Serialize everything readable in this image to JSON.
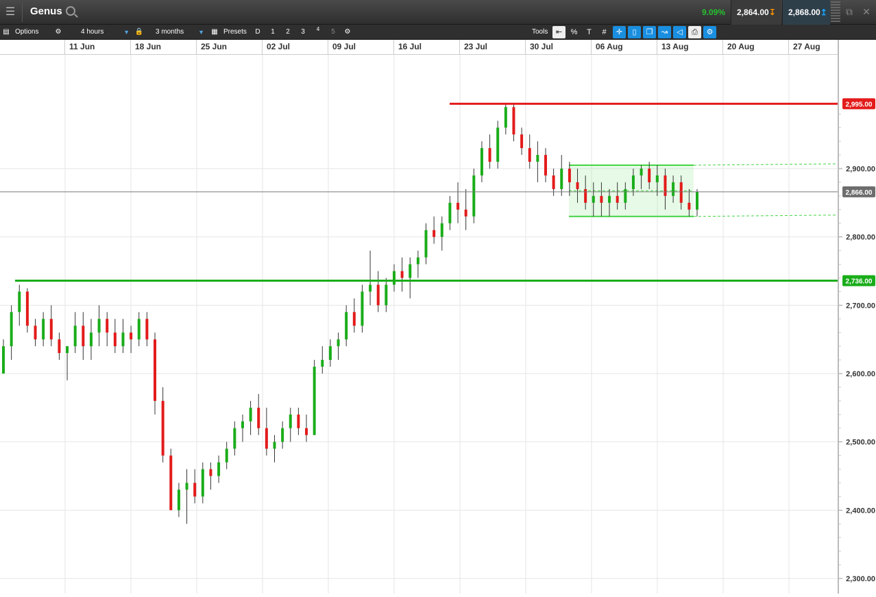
{
  "titlebar": {
    "title": "Genus",
    "change": "9.09%",
    "sell": "2,864.00",
    "buy": "2,868.00"
  },
  "toolbar": {
    "options": "Options",
    "interval": "4 hours",
    "range": "3 months",
    "presets": "Presets",
    "preset_buttons": [
      "D",
      "1",
      "2",
      "3",
      "4",
      "5"
    ],
    "tools": "Tools"
  },
  "chart_data": {
    "type": "candlestick",
    "x_ticks": [
      "11 Jun",
      "18 Jun",
      "25 Jun",
      "02 Jul",
      "09 Jul",
      "16 Jul",
      "23 Jul",
      "30 Jul",
      "06 Aug",
      "13 Aug",
      "20 Aug",
      "27 Aug"
    ],
    "y_ticks": [
      2300,
      2400,
      2500,
      2600,
      2700,
      2800,
      2900
    ],
    "y_tick_labels": [
      "2,300.00",
      "2,400.00",
      "2,500.00",
      "2,600.00",
      "2,700.00",
      "2,800.00",
      "2,900.00"
    ],
    "ylim": [
      2280,
      3010
    ],
    "current_price": 2866,
    "current_price_label": "2,866.00",
    "resistance": {
      "value": 2995,
      "label": "2,995.00",
      "color": "#e31b1b"
    },
    "support": {
      "value": 2736,
      "label": "2,736.00",
      "color": "#1aad1a"
    },
    "channel": {
      "upper": 2905,
      "lower": 2830,
      "color": "#42d442"
    },
    "colors": {
      "up": "#1aad1a",
      "down": "#e31b1b"
    },
    "candles": [
      [
        2600,
        2650,
        2600,
        2640
      ],
      [
        2640,
        2700,
        2620,
        2690
      ],
      [
        2690,
        2730,
        2670,
        2720
      ],
      [
        2720,
        2725,
        2660,
        2670
      ],
      [
        2670,
        2680,
        2640,
        2650
      ],
      [
        2650,
        2690,
        2640,
        2680
      ],
      [
        2680,
        2700,
        2640,
        2650
      ],
      [
        2650,
        2660,
        2620,
        2630
      ],
      [
        2630,
        2640,
        2590,
        2640
      ],
      [
        2640,
        2690,
        2630,
        2670
      ],
      [
        2670,
        2690,
        2620,
        2640
      ],
      [
        2640,
        2680,
        2620,
        2660
      ],
      [
        2660,
        2700,
        2640,
        2680
      ],
      [
        2680,
        2690,
        2640,
        2660
      ],
      [
        2660,
        2680,
        2630,
        2640
      ],
      [
        2640,
        2680,
        2630,
        2660
      ],
      [
        2660,
        2670,
        2630,
        2650
      ],
      [
        2650,
        2690,
        2640,
        2680
      ],
      [
        2680,
        2690,
        2640,
        2650
      ],
      [
        2650,
        2660,
        2540,
        2560
      ],
      [
        2560,
        2580,
        2470,
        2480
      ],
      [
        2480,
        2490,
        2400,
        2400
      ],
      [
        2400,
        2440,
        2390,
        2430
      ],
      [
        2430,
        2460,
        2380,
        2440
      ],
      [
        2440,
        2460,
        2410,
        2420
      ],
      [
        2420,
        2470,
        2410,
        2460
      ],
      [
        2460,
        2470,
        2430,
        2450
      ],
      [
        2450,
        2480,
        2440,
        2470
      ],
      [
        2470,
        2500,
        2460,
        2490
      ],
      [
        2490,
        2530,
        2480,
        2520
      ],
      [
        2520,
        2540,
        2500,
        2530
      ],
      [
        2530,
        2560,
        2510,
        2550
      ],
      [
        2550,
        2570,
        2510,
        2520
      ],
      [
        2520,
        2550,
        2480,
        2490
      ],
      [
        2490,
        2510,
        2470,
        2500
      ],
      [
        2500,
        2530,
        2490,
        2520
      ],
      [
        2520,
        2550,
        2500,
        2540
      ],
      [
        2540,
        2550,
        2510,
        2520
      ],
      [
        2520,
        2540,
        2500,
        2510
      ],
      [
        2510,
        2620,
        2510,
        2610
      ],
      [
        2610,
        2640,
        2600,
        2620
      ],
      [
        2620,
        2650,
        2610,
        2640
      ],
      [
        2640,
        2660,
        2620,
        2650
      ],
      [
        2650,
        2700,
        2640,
        2690
      ],
      [
        2690,
        2710,
        2660,
        2670
      ],
      [
        2670,
        2730,
        2660,
        2720
      ],
      [
        2720,
        2780,
        2700,
        2730
      ],
      [
        2730,
        2750,
        2690,
        2700
      ],
      [
        2700,
        2740,
        2690,
        2730
      ],
      [
        2730,
        2760,
        2720,
        2750
      ],
      [
        2750,
        2770,
        2720,
        2740
      ],
      [
        2740,
        2770,
        2710,
        2760
      ],
      [
        2760,
        2780,
        2740,
        2770
      ],
      [
        2770,
        2820,
        2760,
        2810
      ],
      [
        2810,
        2830,
        2790,
        2800
      ],
      [
        2800,
        2830,
        2780,
        2820
      ],
      [
        2820,
        2860,
        2810,
        2850
      ],
      [
        2850,
        2880,
        2820,
        2840
      ],
      [
        2840,
        2870,
        2810,
        2830
      ],
      [
        2830,
        2900,
        2820,
        2890
      ],
      [
        2890,
        2940,
        2880,
        2930
      ],
      [
        2930,
        2950,
        2900,
        2910
      ],
      [
        2910,
        2970,
        2900,
        2960
      ],
      [
        2960,
        2995,
        2950,
        2990
      ],
      [
        2990,
        2995,
        2940,
        2950
      ],
      [
        2950,
        2960,
        2920,
        2930
      ],
      [
        2930,
        2950,
        2900,
        2910
      ],
      [
        2910,
        2940,
        2880,
        2920
      ],
      [
        2920,
        2930,
        2880,
        2890
      ],
      [
        2890,
        2900,
        2860,
        2870
      ],
      [
        2870,
        2920,
        2860,
        2900
      ],
      [
        2900,
        2910,
        2860,
        2880
      ],
      [
        2880,
        2900,
        2850,
        2870
      ],
      [
        2870,
        2890,
        2840,
        2850
      ],
      [
        2850,
        2880,
        2830,
        2860
      ],
      [
        2860,
        2880,
        2830,
        2850
      ],
      [
        2850,
        2870,
        2830,
        2860
      ],
      [
        2860,
        2880,
        2840,
        2850
      ],
      [
        2850,
        2880,
        2840,
        2870
      ],
      [
        2870,
        2900,
        2860,
        2890
      ],
      [
        2890,
        2905,
        2870,
        2900
      ],
      [
        2900,
        2910,
        2870,
        2880
      ],
      [
        2880,
        2905,
        2860,
        2890
      ],
      [
        2890,
        2900,
        2840,
        2860
      ],
      [
        2860,
        2890,
        2850,
        2880
      ],
      [
        2880,
        2890,
        2840,
        2850
      ],
      [
        2850,
        2870,
        2830,
        2840
      ],
      [
        2840,
        2870,
        2830,
        2866
      ]
    ]
  }
}
